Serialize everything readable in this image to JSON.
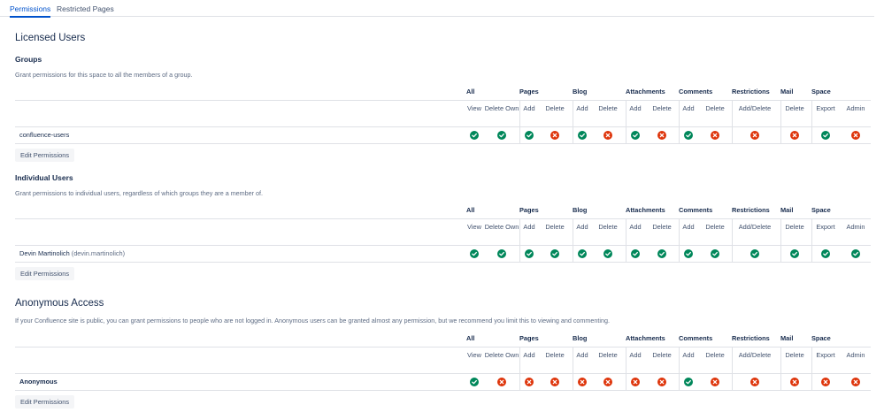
{
  "tabs": [
    {
      "label": "Permissions",
      "active": true
    },
    {
      "label": "Restricted Pages",
      "active": false
    }
  ],
  "licensed_users_title": "Licensed Users",
  "anonymous_title": "Anonymous Access",
  "columns": {
    "groups": [
      {
        "label": "All",
        "subs": [
          "View",
          "Delete Own"
        ]
      },
      {
        "label": "Pages",
        "subs": [
          "Add",
          "Delete"
        ]
      },
      {
        "label": "Blog",
        "subs": [
          "Add",
          "Delete"
        ]
      },
      {
        "label": "Attachments",
        "subs": [
          "Add",
          "Delete"
        ]
      },
      {
        "label": "Comments",
        "subs": [
          "Add",
          "Delete"
        ]
      },
      {
        "label": "Restrictions",
        "subs": [
          "Add/Delete"
        ]
      },
      {
        "label": "Mail",
        "subs": [
          "Delete"
        ]
      },
      {
        "label": "Space",
        "subs": [
          "Export",
          "Admin"
        ]
      }
    ]
  },
  "sections": [
    {
      "title": "Groups",
      "description": "Grant permissions for this space to all the members of a group.",
      "rows": [
        {
          "name": "confluence-users",
          "username": "",
          "bold": false,
          "perms": [
            true,
            true,
            true,
            false,
            true,
            false,
            true,
            false,
            true,
            false,
            false,
            false,
            true,
            false
          ]
        }
      ],
      "button": "Edit Permissions"
    },
    {
      "title": "Individual Users",
      "description": "Grant permissions to individual users, regardless of which groups they are a member of.",
      "rows": [
        {
          "name": "Devin Martinolich",
          "username": "(devin.martinolich)",
          "bold": false,
          "perms": [
            true,
            true,
            true,
            true,
            true,
            true,
            true,
            true,
            true,
            true,
            true,
            true,
            true,
            true
          ]
        }
      ],
      "button": "Edit Permissions"
    },
    {
      "title": "",
      "description": "If your Confluence site is public, you can grant permissions to people who are not logged in. Anonymous users can be granted almost any permission, but we recommend you limit this to viewing and commenting.",
      "rows": [
        {
          "name": "Anonymous",
          "username": "",
          "bold": true,
          "perms": [
            true,
            false,
            false,
            false,
            false,
            false,
            false,
            false,
            true,
            false,
            false,
            false,
            false,
            false
          ]
        }
      ],
      "button": "Edit Permissions"
    }
  ],
  "icons": {
    "granted": "check-circle-icon",
    "denied": "cross-circle-icon"
  },
  "colors": {
    "granted": "#00875a",
    "denied": "#de350b",
    "accent": "#0052cc"
  }
}
